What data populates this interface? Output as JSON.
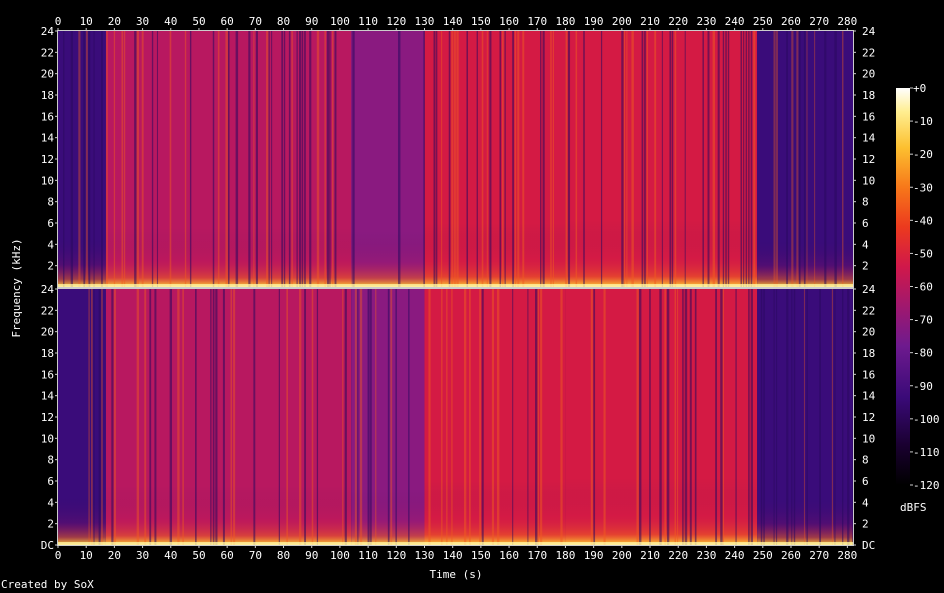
{
  "credit": "Created by SoX",
  "chart_data": {
    "type": "heatmap",
    "xlabel": "Time (s)",
    "ylabel": "Frequency (kHz)",
    "x_ticks": [
      "0",
      "10",
      "20",
      "30",
      "40",
      "50",
      "60",
      "70",
      "80",
      "90",
      "100",
      "110",
      "120",
      "130",
      "140",
      "150",
      "160",
      "170",
      "180",
      "190",
      "200",
      "210",
      "220",
      "230",
      "240",
      "250",
      "260",
      "270",
      "280"
    ],
    "xlim": [
      0,
      282
    ],
    "channels": [
      {
        "y_ticks": [
          "2",
          "4",
          "6",
          "8",
          "10",
          "12",
          "14",
          "16",
          "18",
          "20",
          "22",
          "24"
        ]
      },
      {
        "y_ticks": [
          "DC",
          "2",
          "4",
          "6",
          "8",
          "10",
          "12",
          "14",
          "16",
          "18",
          "20",
          "22",
          "24"
        ]
      }
    ],
    "ylim": [
      0,
      24
    ],
    "colorbar": {
      "label": "dBFS",
      "ticks": [
        "+0",
        "-10",
        "-20",
        "-30",
        "-40",
        "-50",
        "-60",
        "-70",
        "-80",
        "-90",
        "-100",
        "-110",
        "-120"
      ],
      "range": [
        -120,
        0
      ]
    },
    "segments": [
      {
        "t0": 0,
        "t1": 17,
        "level": 0.42
      },
      {
        "t0": 17,
        "t1": 104,
        "level": 0.62
      },
      {
        "t0": 104,
        "t1": 130,
        "level": 0.55
      },
      {
        "t0": 130,
        "t1": 180,
        "level": 0.72
      },
      {
        "t0": 180,
        "t1": 248,
        "level": 0.78
      },
      {
        "t0": 248,
        "t1": 282,
        "level": 0.38
      }
    ],
    "colors": {
      "scale": [
        "#000000",
        "#1a0030",
        "#3a0a78",
        "#6e1a8e",
        "#a0186e",
        "#d0184a",
        "#ec3a1e",
        "#f7781a",
        "#fcc030",
        "#ffee90",
        "#ffffff"
      ]
    }
  }
}
